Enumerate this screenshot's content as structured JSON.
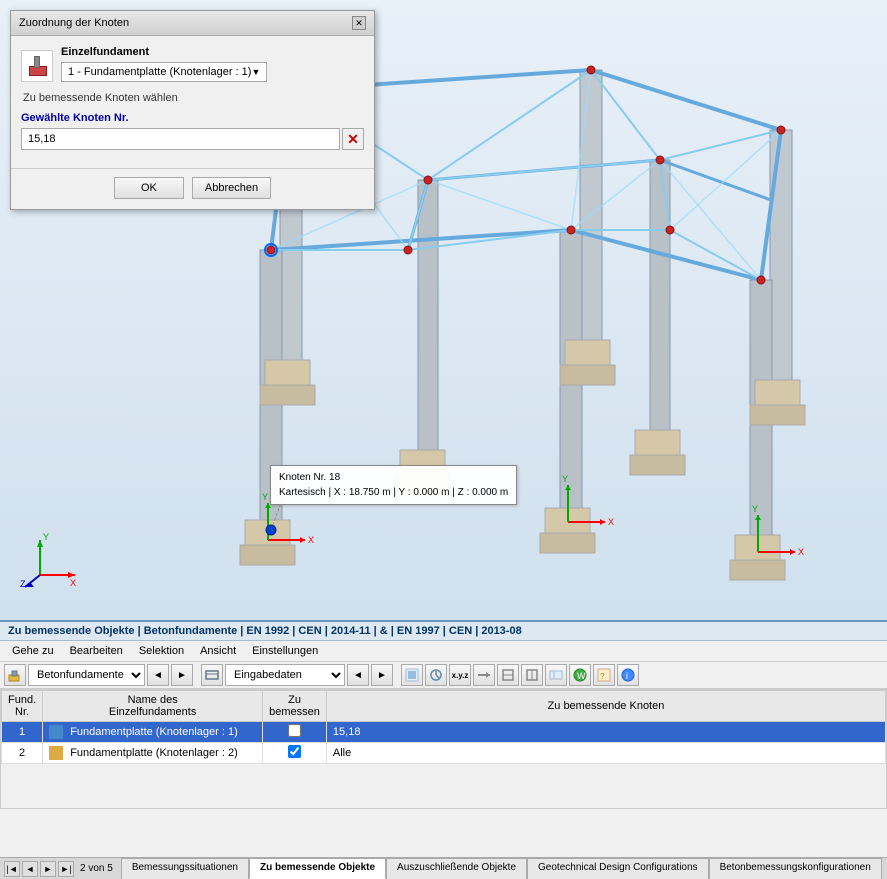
{
  "dialog": {
    "title": "Zuordnung der Knoten",
    "section_label": "Einzelfundament",
    "dropdown_value": "1 - Fundamentplatte (Knotenlager : 1)",
    "help_text": "Zu bemessende Knoten wählen",
    "input_label": "Gewählte Knoten Nr.",
    "input_value": "15,18",
    "ok_label": "OK",
    "cancel_label": "Abbrechen"
  },
  "node_tooltip": {
    "line1": "Knoten Nr. 18",
    "line2": "Kartesisch | X : 18.750 m | Y : 0.000 m | Z : 0.000 m"
  },
  "status_bar": {
    "text": "Zu bemessende Objekte | Betonfundamente | EN 1992 | CEN | 2014-11 | & | EN 1997 | CEN | 2013-08"
  },
  "menu": {
    "items": [
      "Gehe zu",
      "Bearbeiten",
      "Selektion",
      "Ansicht",
      "Einstellungen"
    ]
  },
  "toolbar": {
    "left_select": "Betonfundamente",
    "right_select": "Eingabedaten",
    "nav_prev": "◄",
    "nav_next": "►"
  },
  "table": {
    "headers": [
      "Fund.\nNr.",
      "Name des\nEinzelfundaments",
      "Zu\nbemessen",
      "Zu bemessende Knoten"
    ],
    "col1": "Fund.\nNr.",
    "col2": "Name des Einzelfundaments",
    "col3": "Zu bemessen",
    "col4": "Zu bemessende Knoten",
    "rows": [
      {
        "num": "1",
        "name": "Fundamentplatte (Knotenlager : 1)",
        "checked": false,
        "knoten": "15,18",
        "selected": true,
        "color": "#4488cc"
      },
      {
        "num": "2",
        "name": "Fundamentplatte (Knotenlager : 2)",
        "checked": true,
        "knoten": "Alle",
        "selected": false,
        "color": "#ddaa44"
      }
    ]
  },
  "bottom_tabs": {
    "page_info": "2 von 5",
    "tabs": [
      {
        "label": "Bemessungssituationen",
        "active": false
      },
      {
        "label": "Zu bemessende Objekte",
        "active": true
      },
      {
        "label": "Auszuschließende Objekte",
        "active": false
      },
      {
        "label": "Geotechnical Design Configurations",
        "active": false
      },
      {
        "label": "Betonbemessungskonfigurationen",
        "active": false
      }
    ]
  },
  "axes": {
    "x_label": "X",
    "y_label": "Y",
    "z_label": "Z"
  }
}
